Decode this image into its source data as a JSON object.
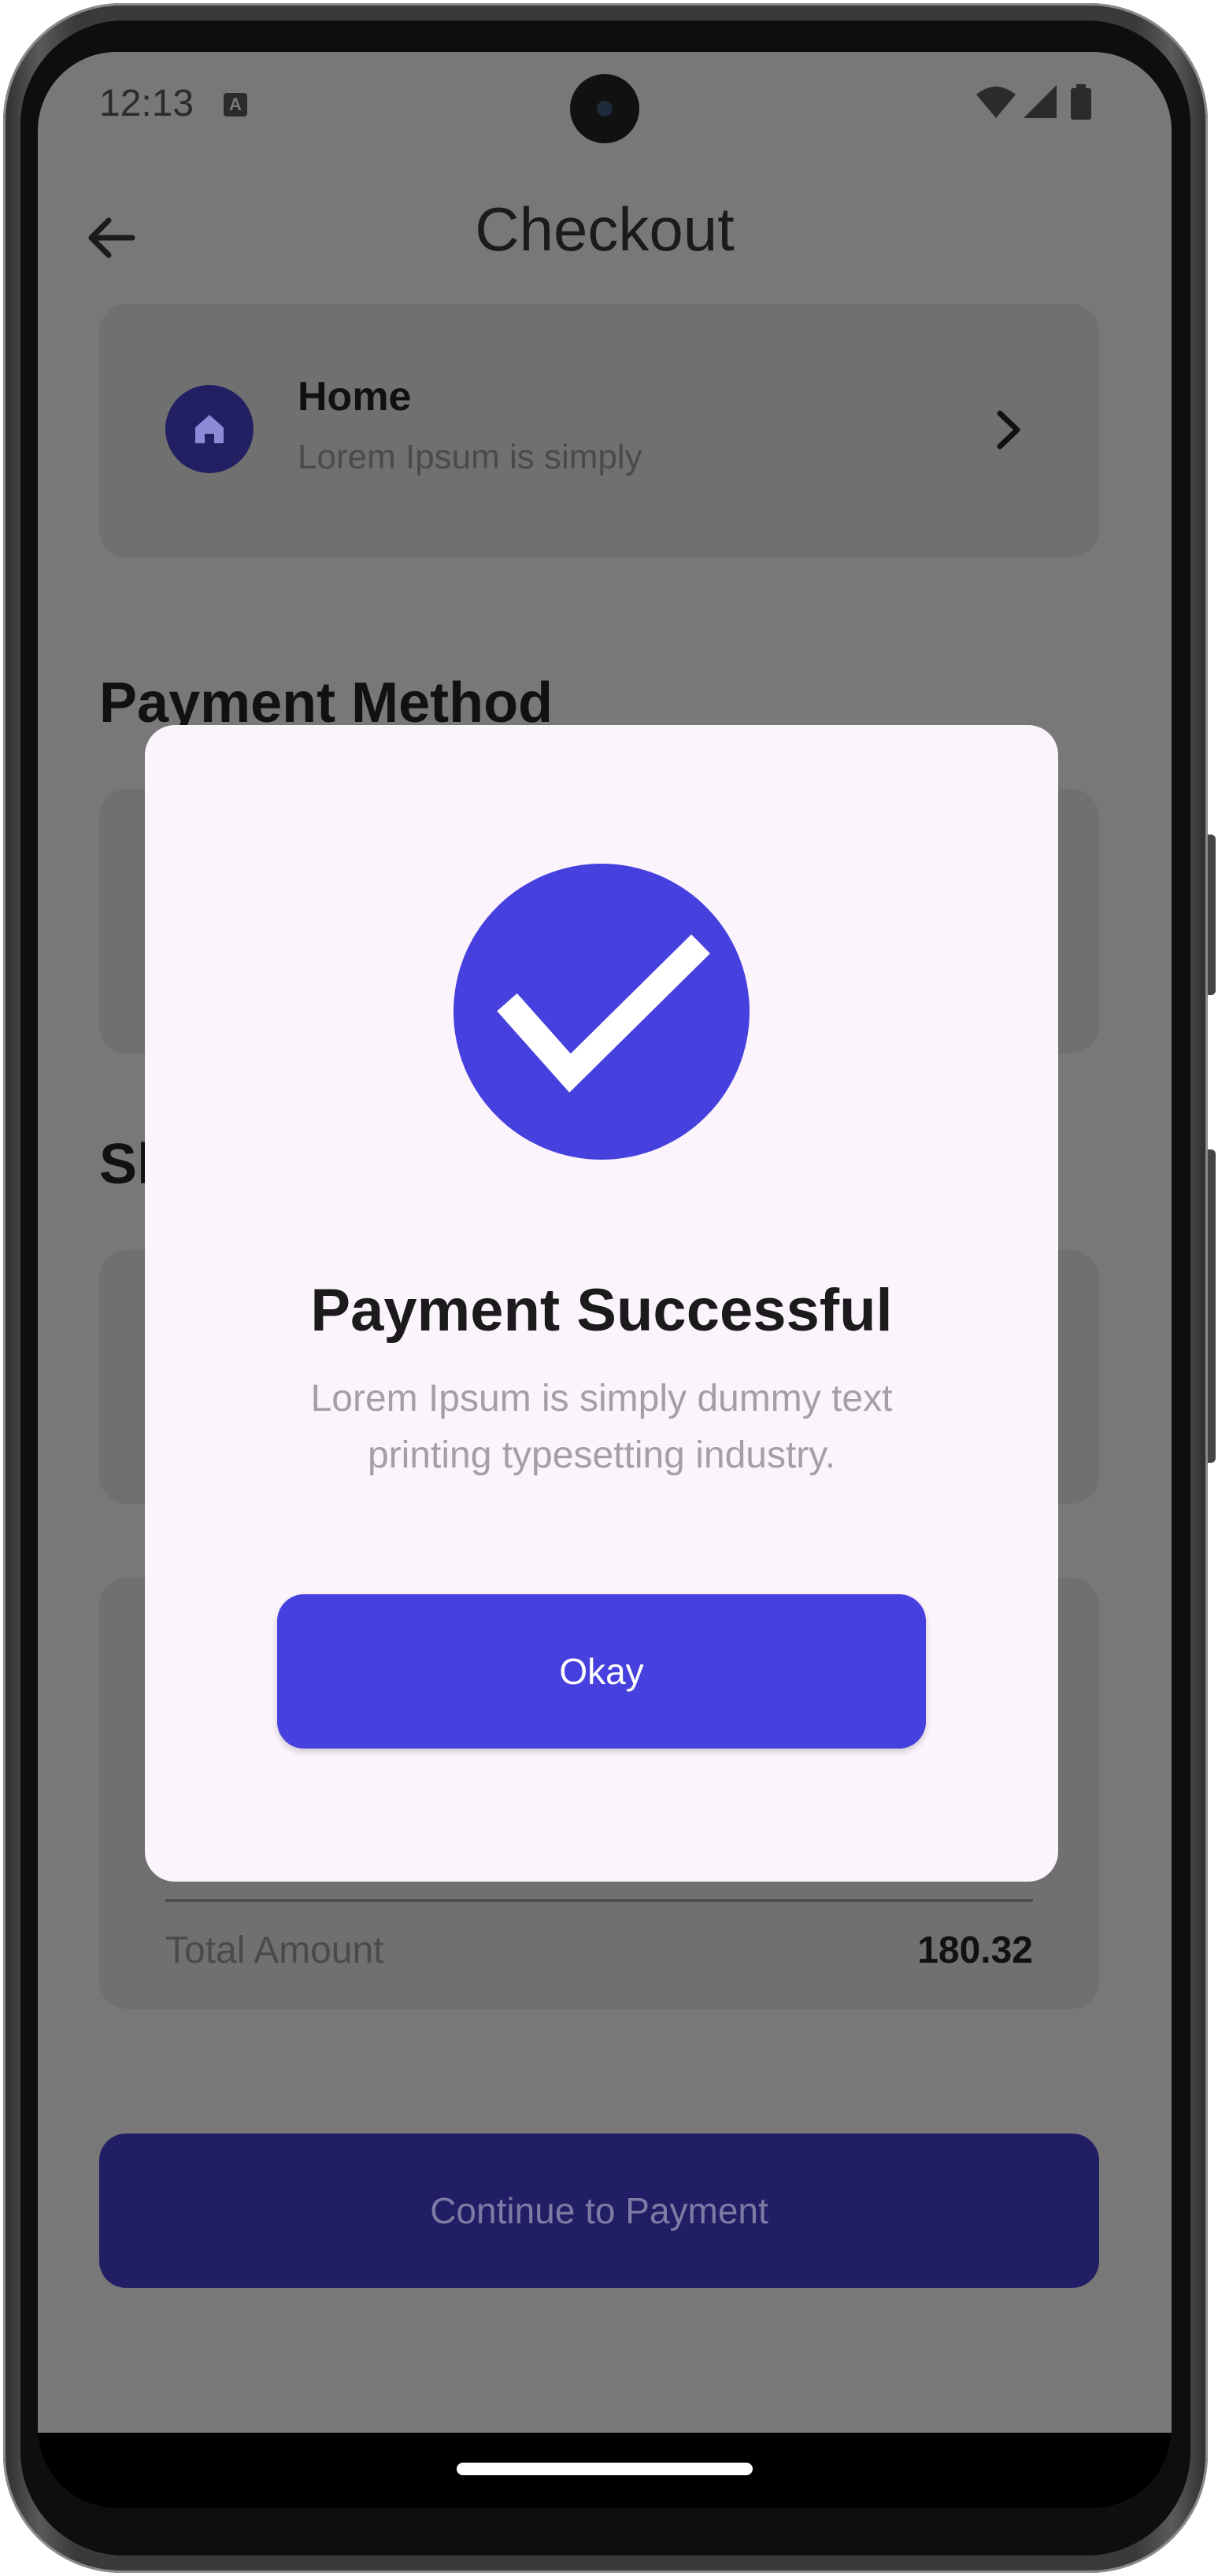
{
  "status_bar": {
    "time": "12:13",
    "notification_icon": "A"
  },
  "header": {
    "title": "Checkout",
    "back_icon": "arrow-left-icon"
  },
  "address": {
    "title": "Home",
    "subtitle": "Lorem Ipsum is simply",
    "icon": "home-icon"
  },
  "sections": {
    "payment_method": "Payment Method",
    "shipping_partial": "Sh"
  },
  "summary": {
    "total_label": "Total Amount",
    "total_value": "180.32"
  },
  "actions": {
    "continue_label": "Continue to Payment"
  },
  "dialog": {
    "title": "Payment Successful",
    "message": "Lorem Ipsum is simply dummy text printing typesetting industry.",
    "button_label": "Okay",
    "icon": "check-circle-icon"
  },
  "colors": {
    "accent": "#4641DE",
    "scrim": "#787878",
    "dialog_bg": "#FCF4FC",
    "dark_accent": "#221E66"
  }
}
